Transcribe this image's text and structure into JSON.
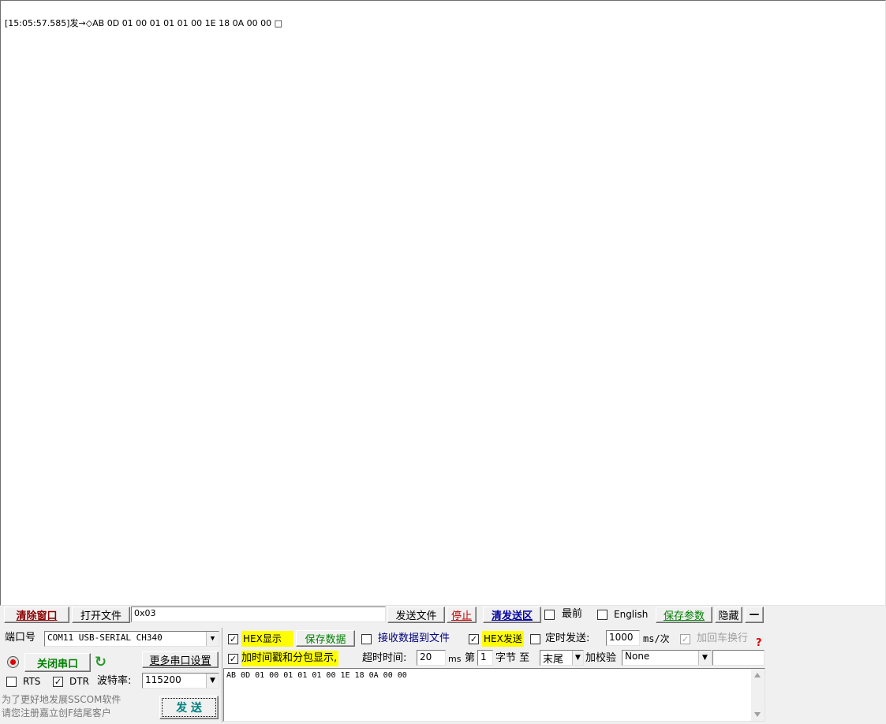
{
  "receive": {
    "line1": "[15:05:57.585]发→◇AB 0D 01 00 01 01 01 00 1E 18 0A 00 00 □"
  },
  "toolbar": {
    "clear_window": "清除窗口",
    "open_file": "打开文件",
    "file_path_value": "0x03",
    "send_file": "发送文件",
    "stop": "停止",
    "clear_send": "清发送区",
    "topmost": "最前",
    "english": "English",
    "save_params": "保存参数",
    "hide": "隐藏",
    "minus": "—"
  },
  "port": {
    "label": "端口号",
    "value": "COM11 USB-SERIAL CH340",
    "close_port": "关闭串口",
    "more_settings": "更多串口设置",
    "rts": "RTS",
    "dtr": "DTR",
    "baud_label": "波特率:",
    "baud_value": "115200",
    "promo1": "为了更好地发展SSCOM软件",
    "promo2": "请您注册嘉立创F结尾客户",
    "send": "发 送"
  },
  "options": {
    "hex_display": "HEX显示",
    "save_data": "保存数据",
    "recv_to_file": "接收数据到文件",
    "hex_send": "HEX发送",
    "timed_send": "定时发送:",
    "interval": "1000",
    "interval_unit": "ms/次",
    "add_crlf": "加回车换行",
    "help": "?",
    "timestamp": "加时间戳和分包显示,",
    "timeout_label": "超时时间:",
    "timeout_value": "20",
    "ms": "ms",
    "byte_no_label": "第",
    "byte_no": "1",
    "byte_label": "字节 至",
    "to_value": "末尾",
    "checksum_label": "加校验",
    "checksum_value": "None"
  },
  "send_area": {
    "text": "AB 0D 01 00 01 01 01 00 1E 18 0A 00 00"
  },
  "colors": {
    "clear_window": "#8b0000",
    "green": "#008000",
    "stop": "#c00000",
    "clear_send": "#0000a0",
    "recv_to_file": "#000080"
  }
}
